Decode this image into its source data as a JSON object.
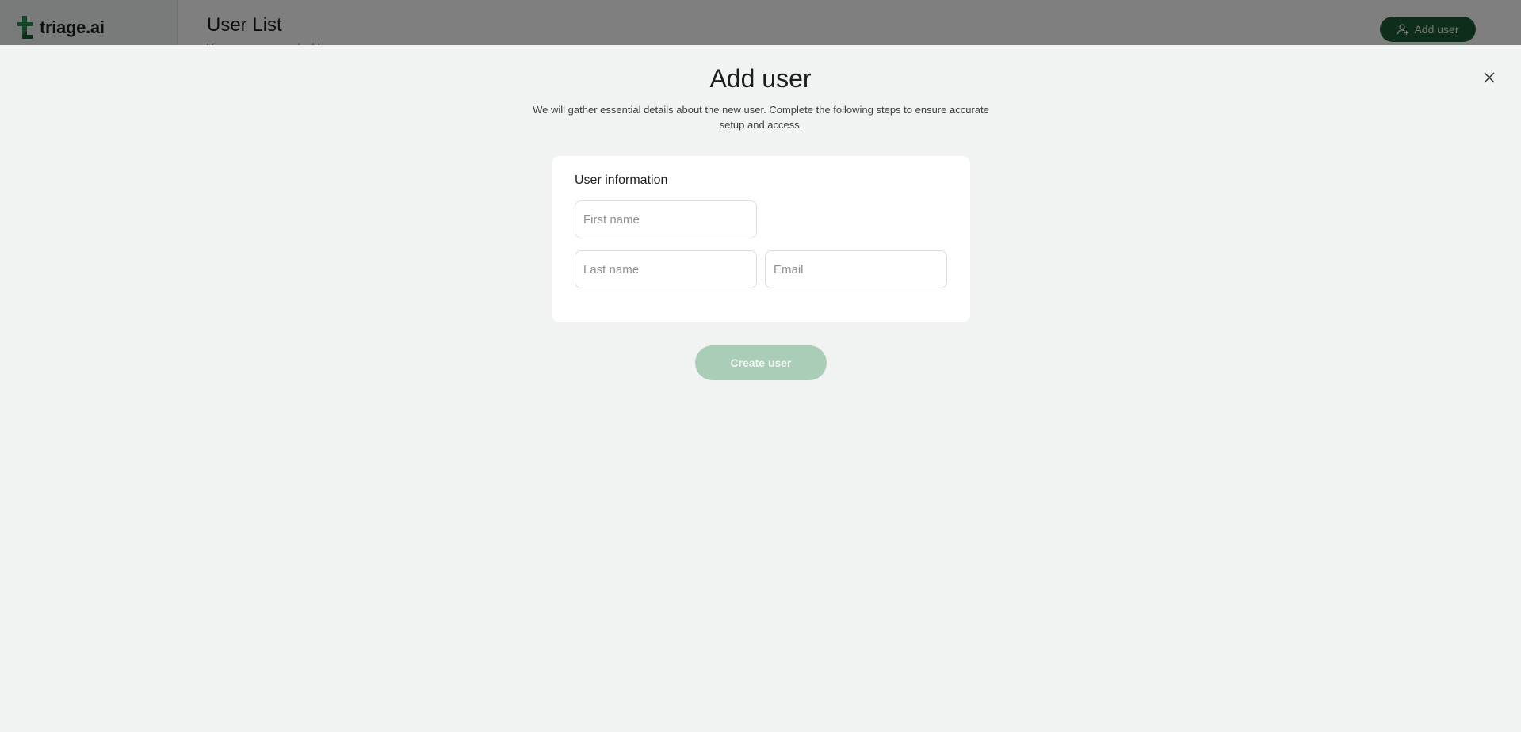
{
  "app": {
    "brand": "triage.ai",
    "brand_color": "#1f5a37"
  },
  "background": {
    "page_title": "User List",
    "page_subtitle": "View your users and add new ones",
    "add_user_label": "Add user"
  },
  "modal": {
    "title": "Add user",
    "description": "We will gather essential details about the new user. Complete the following steps to ensure accurate setup and access.",
    "section_title": "User information",
    "fields": {
      "first_name_placeholder": "First name",
      "last_name_placeholder": "Last name",
      "email_placeholder": "Email"
    },
    "submit_label": "Create user",
    "close_icon": "close-icon"
  }
}
